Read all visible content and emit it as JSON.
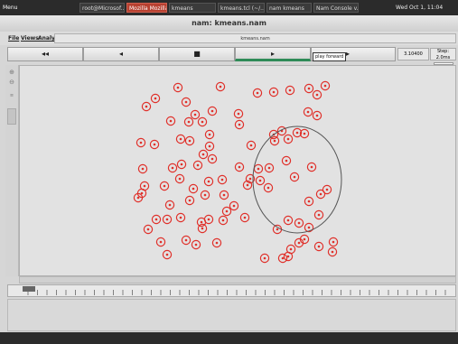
{
  "taskbar": {
    "menu_label": "Menu",
    "tabs": [
      {
        "label": "root@Microsof..."
      },
      {
        "label": "Mozilla Mozilla"
      },
      {
        "label": "kmeans"
      },
      {
        "label": "kmeans.tcl (~/..."
      },
      {
        "label": "nam kmeans"
      },
      {
        "label": "Nam Console v..."
      }
    ],
    "clock": "Wed Oct 1, 11:04"
  },
  "window": {
    "title": "nam: kmeans.nam"
  },
  "menubar": {
    "file": "File",
    "views": "Views",
    "analysis": "Analysis",
    "file_tab": "kmeans.nam"
  },
  "controls": {
    "rewind": "◂◂",
    "back": "◂",
    "stop": "■",
    "play": "▸",
    "fast_forward": "▸▸",
    "tooltip": "play forward",
    "time": "3.10400",
    "step": "Step: 2.0ms"
  },
  "colors": {
    "node": "#e0302a",
    "cluster": "#555555"
  }
}
